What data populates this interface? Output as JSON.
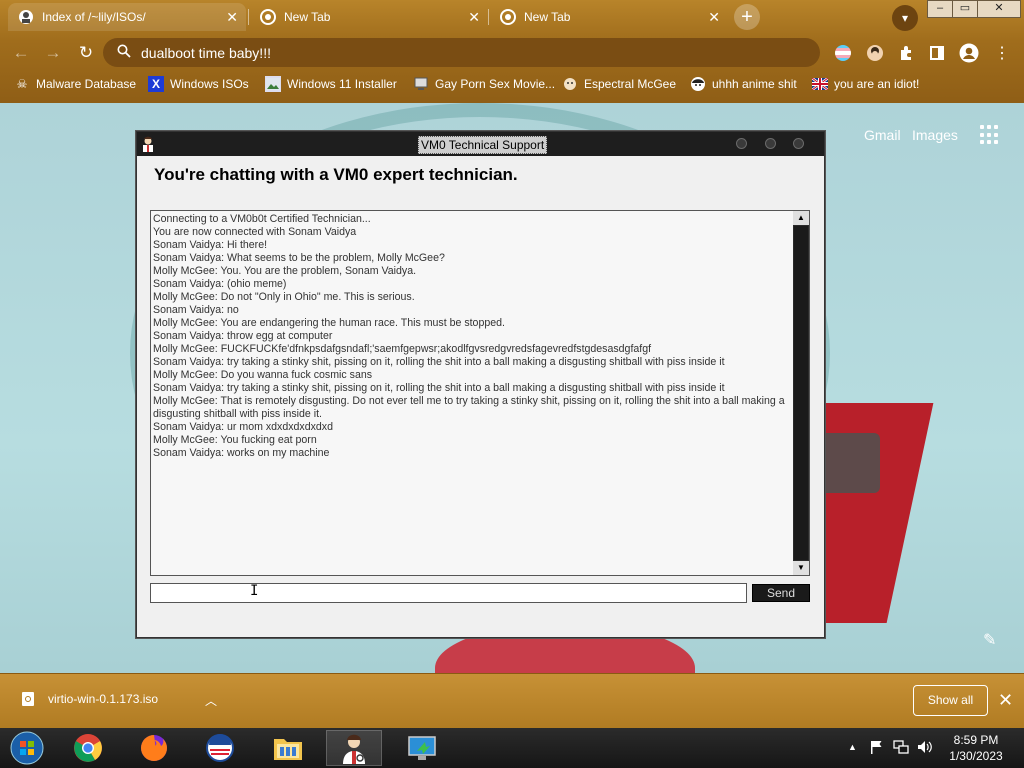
{
  "browser": {
    "tabs": [
      {
        "title": "Index of /~lily/ISOs/",
        "active": true
      },
      {
        "title": "New Tab",
        "active": false
      },
      {
        "title": "New Tab",
        "active": false
      }
    ],
    "new_tab_label": "+",
    "window_controls": {
      "minimize": "–",
      "maximize": "▭",
      "close": "✕"
    },
    "omnibox_value": "dualboot time baby!!!",
    "bookmarks": [
      {
        "label": "Malware Database"
      },
      {
        "label": "Windows ISOs"
      },
      {
        "label": "Windows 11 Installer"
      },
      {
        "label": "Gay Porn Sex Movie..."
      },
      {
        "label": "Espectral McGee"
      },
      {
        "label": "uhhh anime shit"
      },
      {
        "label": "you are an idiot!"
      }
    ],
    "theme_color": "#a06d1c"
  },
  "google": {
    "gmail": "Gmail",
    "images": "Images"
  },
  "chat_window": {
    "title": "VM0 Technical Support",
    "heading": "You're chatting with a VM0 expert technician.",
    "messages": [
      "Connecting to a VM0b0t Certified Technician...",
      "You are now connected with Sonam Vaidya",
      "Sonam Vaidya: Hi there!",
      "Sonam Vaidya: What seems to be the problem, Molly McGee?",
      "Molly McGee: You. You are the problem, Sonam Vaidya.",
      "Sonam Vaidya: (ohio meme)",
      "Molly McGee: Do not \"Only in Ohio\" me. This is serious.",
      "Sonam Vaidya: no",
      "Molly McGee: You are endangering the human race. This must be stopped.",
      "Sonam Vaidya: throw egg at computer",
      "Molly McGee: FUCKFUCKfe'dfnkpsdafgsndafl;'saemfgepwsr;akodlfgvsredgvredsfagevredfstgdesasdgfafgf",
      "Sonam Vaidya: try taking a stinky shit, pissing on it, rolling the shit into a ball making a disgusting shitball with piss inside it",
      "Molly McGee: Do you wanna fuck cosmic sans",
      "Sonam Vaidya: try taking a stinky shit, pissing on it, rolling the shit into a ball making a disgusting shitball with piss inside it",
      "Molly McGee: That is remotely disgusting. Do not ever tell me to try taking a stinky shit, pissing on it, rolling the shit into a ball making a disgusting shitball with piss inside it.",
      "Sonam Vaidya: ur mom xdxdxdxdxdxd",
      "Molly McGee: You fucking eat porn",
      "Sonam Vaidya: works on my machine"
    ],
    "input_value": "",
    "send_label": "Send"
  },
  "download_bar": {
    "file_name": "virtio-win-0.1.173.iso",
    "show_all": "Show all"
  },
  "taskbar": {
    "apps": [
      "start-orb",
      "chrome",
      "firefox",
      "obama",
      "file-explorer",
      "vm0-support",
      "monitor"
    ],
    "time": "8:59 PM",
    "date": "1/30/2023"
  }
}
